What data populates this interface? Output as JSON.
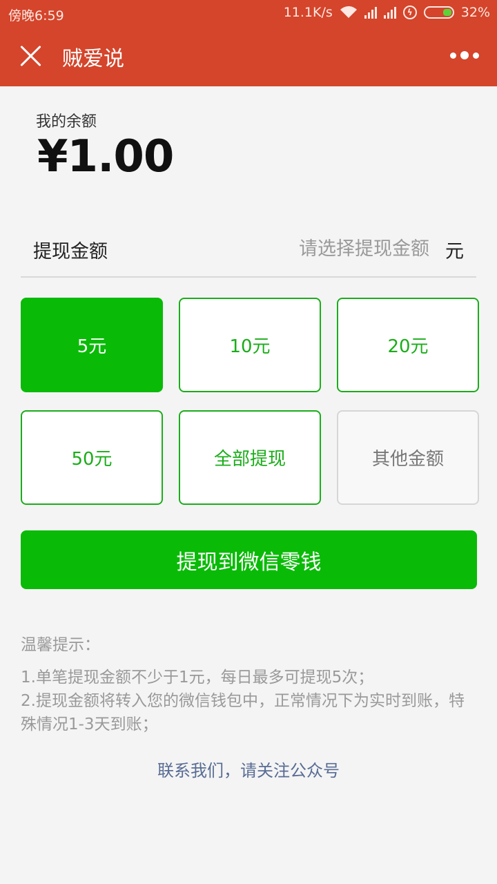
{
  "status_bar": {
    "time": "傍晚6:59",
    "speed": "11.1K/s",
    "battery": "32%"
  },
  "nav": {
    "title": "贼爱说"
  },
  "balance": {
    "label": "我的余额",
    "amount": "¥1.00"
  },
  "withdraw": {
    "label": "提现金额",
    "placeholder": "请选择提现金额",
    "unit": "元"
  },
  "amounts": [
    {
      "label": "5元",
      "state": "selected"
    },
    {
      "label": "10元",
      "state": "normal"
    },
    {
      "label": "20元",
      "state": "normal"
    },
    {
      "label": "50元",
      "state": "normal"
    },
    {
      "label": "全部提现",
      "state": "normal"
    },
    {
      "label": "其他金额",
      "state": "disabled"
    }
  ],
  "submit_label": "提现到微信零钱",
  "tips": {
    "title": "温馨提示：",
    "line1": "1.单笔提现金额不少于1元，每日最多可提现5次；",
    "line2": "2.提现金额将转入您的微信钱包中，正常情况下为实时到账，特殊情况1-3天到账；"
  },
  "contact_label": "联系我们，请关注公众号",
  "colors": {
    "header": "#d4452b",
    "primary_green": "#09bb07",
    "link_blue": "#586c94"
  }
}
